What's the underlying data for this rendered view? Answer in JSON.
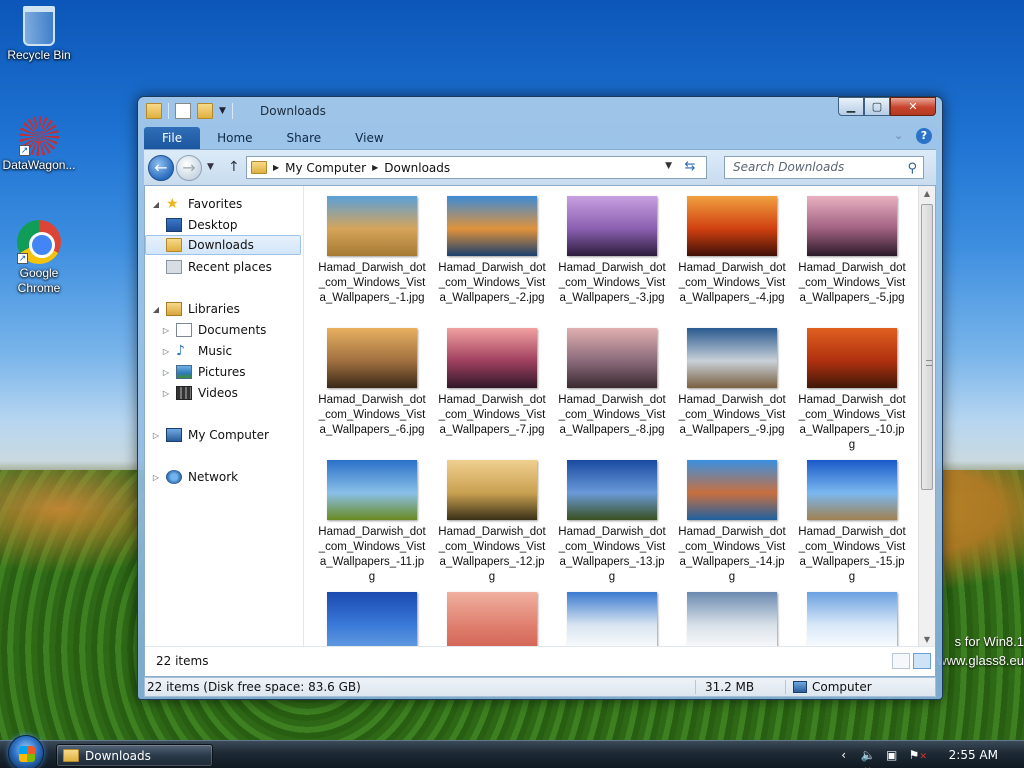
{
  "desktop": {
    "icons": [
      {
        "label": "Recycle Bin"
      },
      {
        "label": "DataWagon..."
      },
      {
        "label": "Google Chrome"
      }
    ],
    "watermark_line1": "s for Win8.1",
    "watermark_line2": "www.glass8.eu"
  },
  "window": {
    "title": "Downloads",
    "ribbon_tabs": [
      "File",
      "Home",
      "Share",
      "View"
    ],
    "address": {
      "crumbs": [
        "My Computer",
        "Downloads"
      ]
    },
    "search_placeholder": "Search Downloads",
    "nav": {
      "favorites": "Favorites",
      "desktop": "Desktop",
      "downloads": "Downloads",
      "recent": "Recent places",
      "libraries": "Libraries",
      "documents": "Documents",
      "music": "Music",
      "pictures": "Pictures",
      "videos": "Videos",
      "computer": "My Computer",
      "network": "Network"
    },
    "files": [
      {
        "name": "Hamad_Darwish_dot_com_Windows_Vista_Wallpapers_-1.jpg",
        "colors": [
          "#5aa0d8",
          "#d6a45a",
          "#a57a34"
        ]
      },
      {
        "name": "Hamad_Darwish_dot_com_Windows_Vista_Wallpapers_-2.jpg",
        "colors": [
          "#3d8bd6",
          "#e0923a",
          "#1b3f6e"
        ]
      },
      {
        "name": "Hamad_Darwish_dot_com_Windows_Vista_Wallpapers_-3.jpg",
        "colors": [
          "#c8a0e0",
          "#8a5fb0",
          "#2c1c3c"
        ]
      },
      {
        "name": "Hamad_Darwish_dot_com_Windows_Vista_Wallpapers_-4.jpg",
        "colors": [
          "#f0a040",
          "#d04010",
          "#401008"
        ]
      },
      {
        "name": "Hamad_Darwish_dot_com_Windows_Vista_Wallpapers_-5.jpg",
        "colors": [
          "#e8b0c0",
          "#a06080",
          "#2a1a28"
        ]
      },
      {
        "name": "Hamad_Darwish_dot_com_Windows_Vista_Wallpapers_-6.jpg",
        "colors": [
          "#e8b060",
          "#a07040",
          "#3a2818"
        ]
      },
      {
        "name": "Hamad_Darwish_dot_com_Windows_Vista_Wallpapers_-7.jpg",
        "colors": [
          "#f0a0a0",
          "#a04060",
          "#301828"
        ]
      },
      {
        "name": "Hamad_Darwish_dot_com_Windows_Vista_Wallpapers_-8.jpg",
        "colors": [
          "#e0b0b0",
          "#8a6a7a",
          "#3a2a30"
        ]
      },
      {
        "name": "Hamad_Darwish_dot_com_Windows_Vista_Wallpapers_-9.jpg",
        "colors": [
          "#2a5a90",
          "#c8d0d8",
          "#7a6040"
        ]
      },
      {
        "name": "Hamad_Darwish_dot_com_Windows_Vista_Wallpapers_-10.jpg",
        "colors": [
          "#e06020",
          "#b03010",
          "#401808"
        ]
      },
      {
        "name": "Hamad_Darwish_dot_com_Windows_Vista_Wallpapers_-11.jpg",
        "colors": [
          "#2a70c8",
          "#8ac0e8",
          "#6a8a20"
        ]
      },
      {
        "name": "Hamad_Darwish_dot_com_Windows_Vista_Wallpapers_-12.jpg",
        "colors": [
          "#f0d090",
          "#c8a050",
          "#3a3018"
        ]
      },
      {
        "name": "Hamad_Darwish_dot_com_Windows_Vista_Wallpapers_-13.jpg",
        "colors": [
          "#1a4aa0",
          "#6a9ad8",
          "#3a5020"
        ]
      },
      {
        "name": "Hamad_Darwish_dot_com_Windows_Vista_Wallpapers_-14.jpg",
        "colors": [
          "#3a90e0",
          "#c87040",
          "#2060a0"
        ]
      },
      {
        "name": "Hamad_Darwish_dot_com_Windows_Vista_Wallpapers_-15.jpg",
        "colors": [
          "#1a5ac8",
          "#7ab8f0",
          "#a08050"
        ]
      },
      {
        "name": "",
        "colors": [
          "#1a4ab0",
          "#3a7ad8",
          "#6aa0e0"
        ]
      },
      {
        "name": "",
        "colors": [
          "#f0b0a0",
          "#e08070",
          "#d06050"
        ]
      },
      {
        "name": "",
        "colors": [
          "#3a7ad0",
          "#d8e4f0",
          "#ffffff"
        ]
      },
      {
        "name": "",
        "colors": [
          "#6a8ab0",
          "#d8e0e8",
          "#ffffff"
        ]
      },
      {
        "name": "",
        "colors": [
          "#6aa0e0",
          "#d8e8f8",
          "#ffffff"
        ]
      }
    ],
    "details_count": "22 items",
    "status": {
      "items": "22 items (Disk free space: 83.6 GB)",
      "size": "31.2 MB",
      "location": "Computer"
    }
  },
  "taskbar": {
    "task_label": "Downloads",
    "clock": "2:55 AM"
  }
}
